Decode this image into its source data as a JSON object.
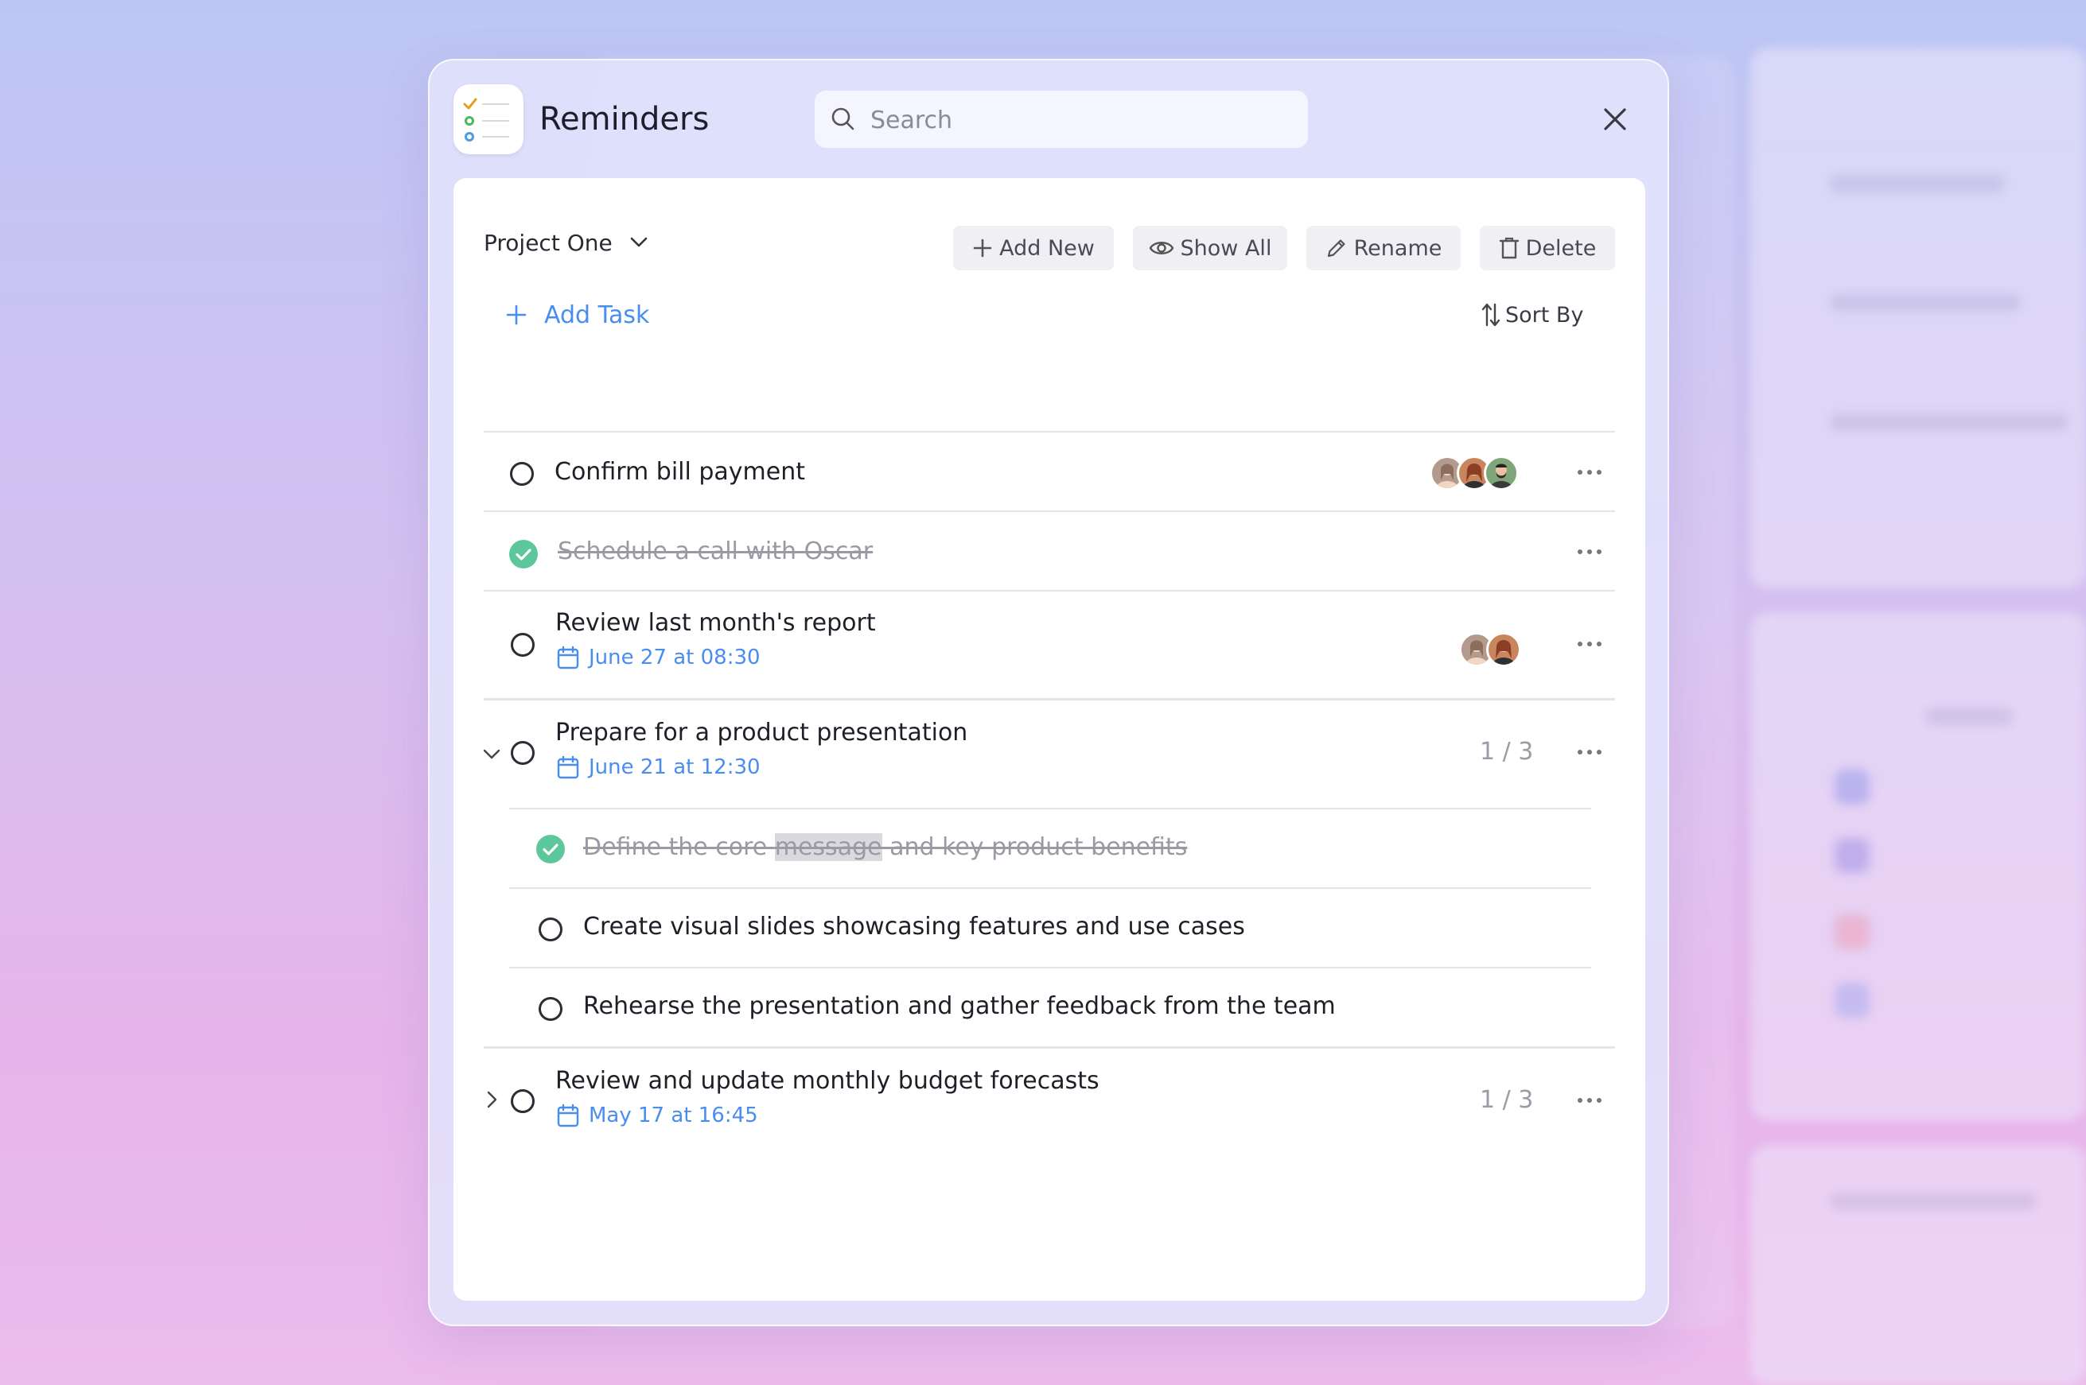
{
  "app": {
    "title": "Reminders",
    "search_placeholder": "Search"
  },
  "toolbar": {
    "project": "Project One",
    "add_new": "Add New",
    "show_all": "Show All",
    "rename": "Rename",
    "delete": "Delete",
    "add_task": "Add Task",
    "sort_by": "Sort By"
  },
  "tasks": [
    {
      "title": "Confirm bill payment",
      "done": false,
      "avatars": 3
    },
    {
      "title": "Schedule a call with Oscar",
      "done": true
    },
    {
      "title": "Review last month's report",
      "done": false,
      "date": "June 27 at 08:30",
      "avatars": 2
    },
    {
      "title": "Prepare for a product presentation",
      "done": false,
      "date": "June 21 at 12:30",
      "progress": "1 / 3",
      "expanded": true,
      "subtasks": [
        {
          "title_before": "Define the core ",
          "title_highlight": "message",
          "title_after": " and key product benefits",
          "done": true
        },
        {
          "title": "Create visual slides showcasing features and use cases",
          "done": false
        },
        {
          "title": "Rehearse the presentation and gather feedback from the team",
          "done": false
        }
      ]
    },
    {
      "title": "Review and update monthly budget forecasts",
      "done": false,
      "date": "May 17 at 16:45",
      "progress": "1 / 3",
      "expanded": false
    }
  ],
  "colors": {
    "accent": "#4a8df0",
    "done_green": "#5cc79a",
    "text": "#1f1f28",
    "muted": "#9a9aa4"
  },
  "icons": [
    "search-icon",
    "close-icon",
    "chevron-down-icon",
    "plus-icon",
    "eye-icon",
    "pencil-icon",
    "trash-icon",
    "sort-icon",
    "calendar-icon",
    "more-icon",
    "check-icon",
    "chevron-right-icon"
  ]
}
